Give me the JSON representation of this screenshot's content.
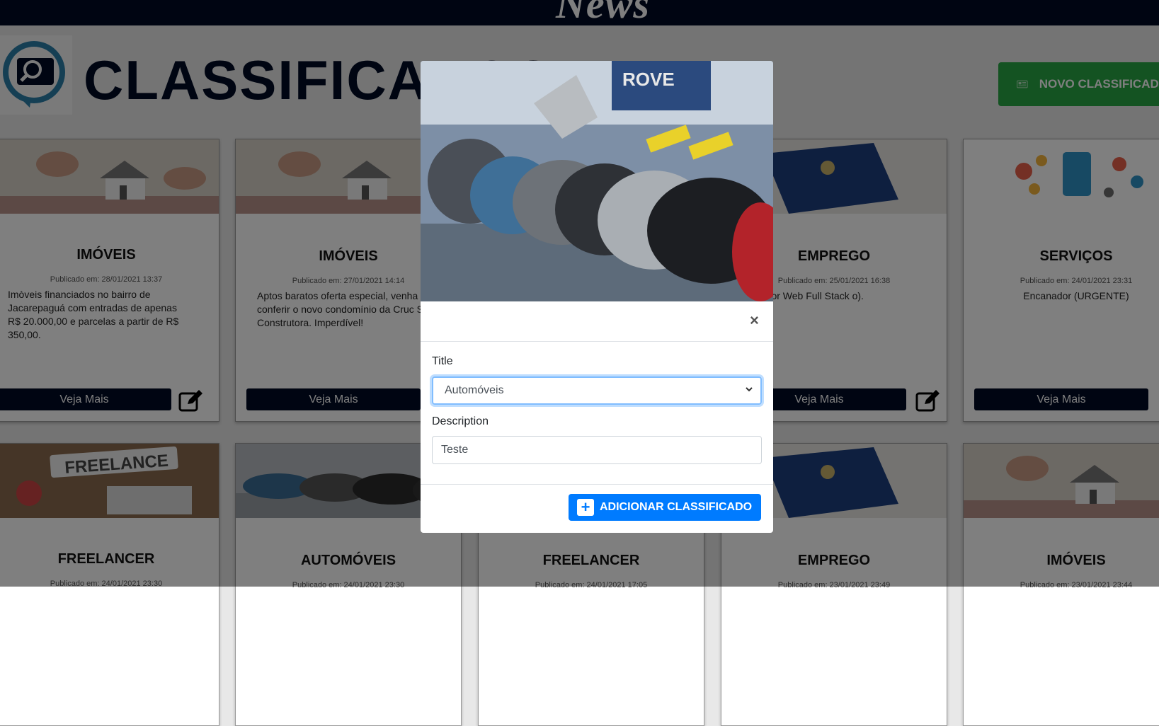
{
  "topbar": {
    "brand_script": "News"
  },
  "header": {
    "title": "CLASSIFICADOS",
    "new_button_label": "NOVO CLASSIFICADO",
    "colors": {
      "primary": "#000a24",
      "success": "#28a745",
      "accent": "#007bff"
    }
  },
  "cards": [
    {
      "category": "IMÓVEIS",
      "date": "Publicado em: 28/01/2021 13:37",
      "description": "Imòveis financiados no bairro de Jacarepaguá com entradas de apenas R$ 20.000,00 e parcelas a partir de R$ 350,00.",
      "button": "Veja Mais",
      "image": "house-keys"
    },
    {
      "category": "IMÓVEIS",
      "date": "Publicado em: 27/01/2021 14:14",
      "description": "Aptos baratos oferta especial, venha conferir o novo condomínio da Cruc SSD Construtora. Imperdível!",
      "button": "Veja Mais",
      "image": "house-keys"
    },
    {
      "category": "EMPREGO",
      "date": "Publicado em: 25/01/2021 16:38",
      "description": "volvedor Web Full Stack o).",
      "button": "Veja Mais",
      "image": "work-card"
    },
    {
      "category": "SERVIÇOS",
      "date": "Publicado em: 24/01/2021 23:31",
      "description": "Encanador (URGENTE)",
      "button": "Veja Mais",
      "image": "services-icons"
    },
    {
      "category": "FREELANCER",
      "date": "Publicado em: 24/01/2021 23:30",
      "image": "freelance-desk"
    },
    {
      "category": "AUTOMÓVEIS",
      "date": "Publicado em: 24/01/2021 23:30",
      "image": "cars-showroom"
    },
    {
      "category": "FREELANCER",
      "date": "Publicado em: 24/01/2021 17:05",
      "image": "freelance-desk"
    },
    {
      "category": "EMPREGO",
      "date": "Publicado em: 23/01/2021 23:49",
      "image": "work-card"
    },
    {
      "category": "IMÓVEIS",
      "date": "Publicado em: 23/01/2021 23:44",
      "image": "house-keys"
    }
  ],
  "modal": {
    "hero_image": "cars-showroom",
    "close_symbol": "×",
    "title_label": "Title",
    "title_selected": "Automóveis",
    "description_label": "Description",
    "description_value": "Teste",
    "submit_label": "ADICIONAR CLASSIFICADO",
    "submit_icon": "plus-square-icon"
  }
}
